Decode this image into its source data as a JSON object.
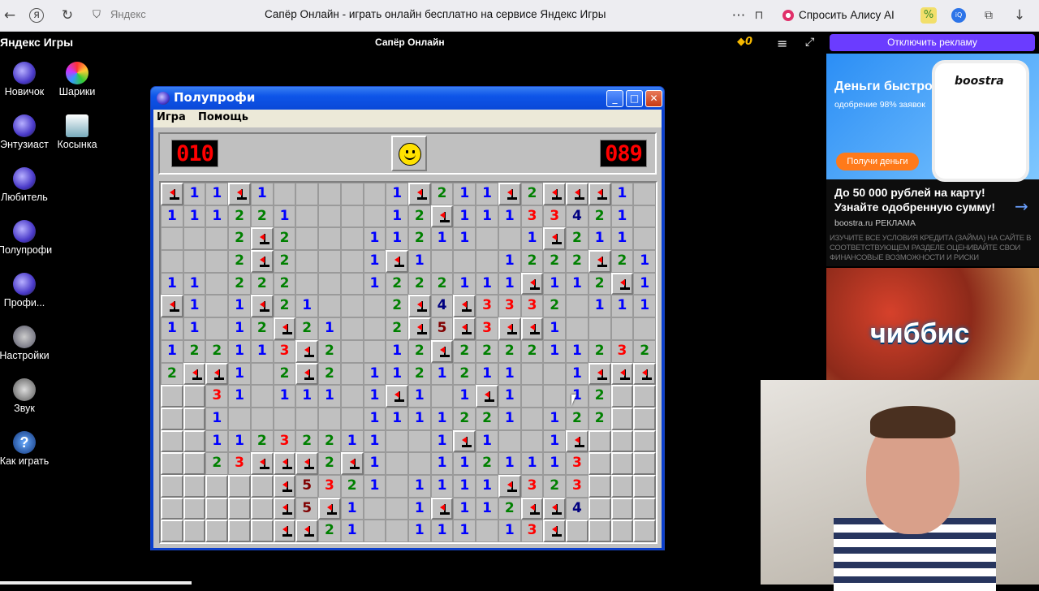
{
  "browser": {
    "address": "Яндекс",
    "page_title": "Сапёр Онлайн - играть онлайн бесплатно на сервисе Яндекс Игры",
    "alice": "Спросить Алису AI"
  },
  "gamebar": {
    "logo": "Яндекс Игры",
    "title": "Сапёр Онлайн",
    "coins": "0",
    "remove_ads": "Отключить рекламу"
  },
  "desktop": {
    "icons": [
      {
        "label": "Новичок"
      },
      {
        "label": "Шарики"
      },
      {
        "label": "Энтузиаст"
      },
      {
        "label": "Косынка"
      },
      {
        "label": "Любитель"
      },
      {
        "label": "Полупрофи"
      },
      {
        "label": "Профи..."
      },
      {
        "label": "Настройки"
      },
      {
        "label": "Звук"
      },
      {
        "label": "Как играть"
      }
    ]
  },
  "window": {
    "title": "Полупрофи",
    "menu": [
      "Игра",
      "Помощь"
    ],
    "mines_left": "010",
    "timer": "089",
    "face": "smile"
  },
  "board": {
    "rows": [
      [
        "F",
        "1",
        "1",
        "F",
        "1",
        "",
        "",
        "",
        "",
        "",
        "1",
        "F",
        "2",
        "1",
        "1",
        "F",
        "2",
        "F",
        "F",
        "F",
        "1",
        ""
      ],
      [
        "1",
        "1",
        "1",
        "2",
        "2",
        "1",
        "",
        "",
        "",
        "",
        "1",
        "2",
        "F",
        "1",
        "1",
        "1",
        "3",
        "3",
        "4",
        "2",
        "1",
        ""
      ],
      [
        "",
        "",
        "",
        "2",
        "F",
        "2",
        "",
        "",
        "",
        "1",
        "1",
        "2",
        "1",
        "1",
        "",
        "",
        "1",
        "F",
        "2",
        "1",
        "1",
        ""
      ],
      [
        "",
        "",
        "",
        "2",
        "F",
        "2",
        "",
        "",
        "",
        "1",
        "F",
        "1",
        "",
        "",
        "",
        "1",
        "2",
        "2",
        "2",
        "F",
        "2",
        "1"
      ],
      [
        "1",
        "1",
        "",
        "2",
        "2",
        "2",
        "",
        "",
        "",
        "1",
        "2",
        "2",
        "2",
        "1",
        "1",
        "1",
        "F",
        "1",
        "1",
        "2",
        "F",
        "1"
      ],
      [
        "F",
        "1",
        "",
        "1",
        "F",
        "2",
        "1",
        "",
        "",
        "",
        "2",
        "F",
        "4",
        "F",
        "3",
        "3",
        "3",
        "2",
        "",
        "1",
        "1",
        "1"
      ],
      [
        "1",
        "1",
        "",
        "1",
        "2",
        "F",
        "2",
        "1",
        "",
        "",
        "2",
        "F",
        "5",
        "F",
        "3",
        "F",
        "F",
        "1",
        "",
        "",
        "",
        ""
      ],
      [
        "1",
        "2",
        "2",
        "1",
        "1",
        "3",
        "F",
        "2",
        "",
        "",
        "1",
        "2",
        "F",
        "2",
        "2",
        "2",
        "2",
        "1",
        "1",
        "2",
        "3",
        "2"
      ],
      [
        "2",
        "F",
        "F",
        "1",
        "",
        "2",
        "F",
        "2",
        "",
        "1",
        "1",
        "2",
        "1",
        "2",
        "1",
        "1",
        "",
        "",
        "1",
        "F",
        "F",
        "F"
      ],
      [
        "H",
        "H",
        "3",
        "1",
        "",
        "1",
        "1",
        "1",
        "",
        "1",
        "F",
        "1",
        "",
        "1",
        "F",
        "1",
        "",
        "",
        "1",
        "2",
        "H",
        "H"
      ],
      [
        "H",
        "H",
        "1",
        "",
        "",
        "",
        "",
        "",
        "",
        "1",
        "1",
        "1",
        "1",
        "2",
        "2",
        "1",
        "",
        "1",
        "2",
        "2",
        "H",
        "H"
      ],
      [
        "H",
        "H",
        "1",
        "1",
        "2",
        "3",
        "2",
        "2",
        "1",
        "1",
        "",
        "",
        "1",
        "F",
        "1",
        "",
        "",
        "1",
        "F",
        "H",
        "H",
        "H"
      ],
      [
        "H",
        "H",
        "2",
        "3",
        "F",
        "F",
        "F",
        "2",
        "F",
        "1",
        "",
        "",
        "1",
        "1",
        "2",
        "1",
        "1",
        "1",
        "3",
        "H",
        "H",
        "H"
      ],
      [
        "H",
        "H",
        "H",
        "H",
        "H",
        "F",
        "5",
        "3",
        "2",
        "1",
        "",
        "1",
        "1",
        "1",
        "1",
        "F",
        "3",
        "2",
        "3",
        "H",
        "H",
        "H"
      ],
      [
        "H",
        "H",
        "H",
        "H",
        "H",
        "F",
        "5",
        "F",
        "1",
        "",
        "",
        "1",
        "F",
        "1",
        "1",
        "2",
        "F",
        "F",
        "4",
        "H",
        "H",
        "H"
      ],
      [
        "H",
        "H",
        "H",
        "H",
        "H",
        "F",
        "F",
        "2",
        "1",
        "",
        "",
        "1",
        "1",
        "1",
        "",
        "1",
        "3",
        "F",
        "H",
        "H",
        "H",
        "H"
      ]
    ]
  },
  "ads": {
    "ad1": {
      "headline": "Деньги быстро",
      "sub": "одобрение 98% заявок",
      "brand": "boostra",
      "button": "Получи деньги",
      "text": "До 50 000 рублей на карту! Узнайте одобренную сумму!",
      "source": "boostra.ru  РЕКЛАМА",
      "warning": "Изучите все условия кредита (займа) на сайте в соответствующем разделе оценивайте свои финансовые возможности и риски"
    },
    "ad2": {
      "brand": "чиббис"
    }
  }
}
